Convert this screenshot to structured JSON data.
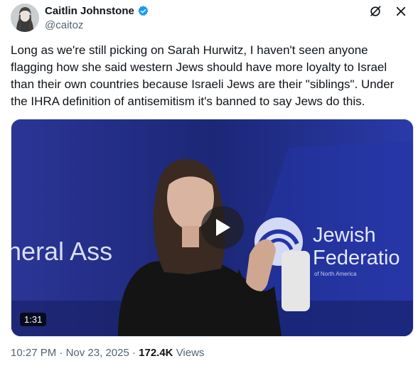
{
  "author": {
    "display_name": "Caitlin Johnstone",
    "handle": "@caitoz"
  },
  "post": {
    "text": "Long as we're still picking on Sarah Hurwitz, I haven't seen anyone flagging how she said western Jews should have more loyalty to Israel than their own countries because Israeli Jews are their \"siblings\". Under the IHRA definition of antisemitism it's banned to say Jews do this."
  },
  "media": {
    "duration": "1:31",
    "backdrop_left_text": "neral Ass",
    "logo_line1": "Jewish",
    "logo_line2": "Federatio",
    "logo_line3": "of North America"
  },
  "meta": {
    "time": "10:27 PM",
    "separator": "·",
    "date": "Nov 23, 2025",
    "views_count": "172.4K",
    "views_label": "Views"
  },
  "colors": {
    "verified": "#1d9bf0",
    "stage_blue": "#2434a8",
    "text_secondary": "#536471"
  }
}
